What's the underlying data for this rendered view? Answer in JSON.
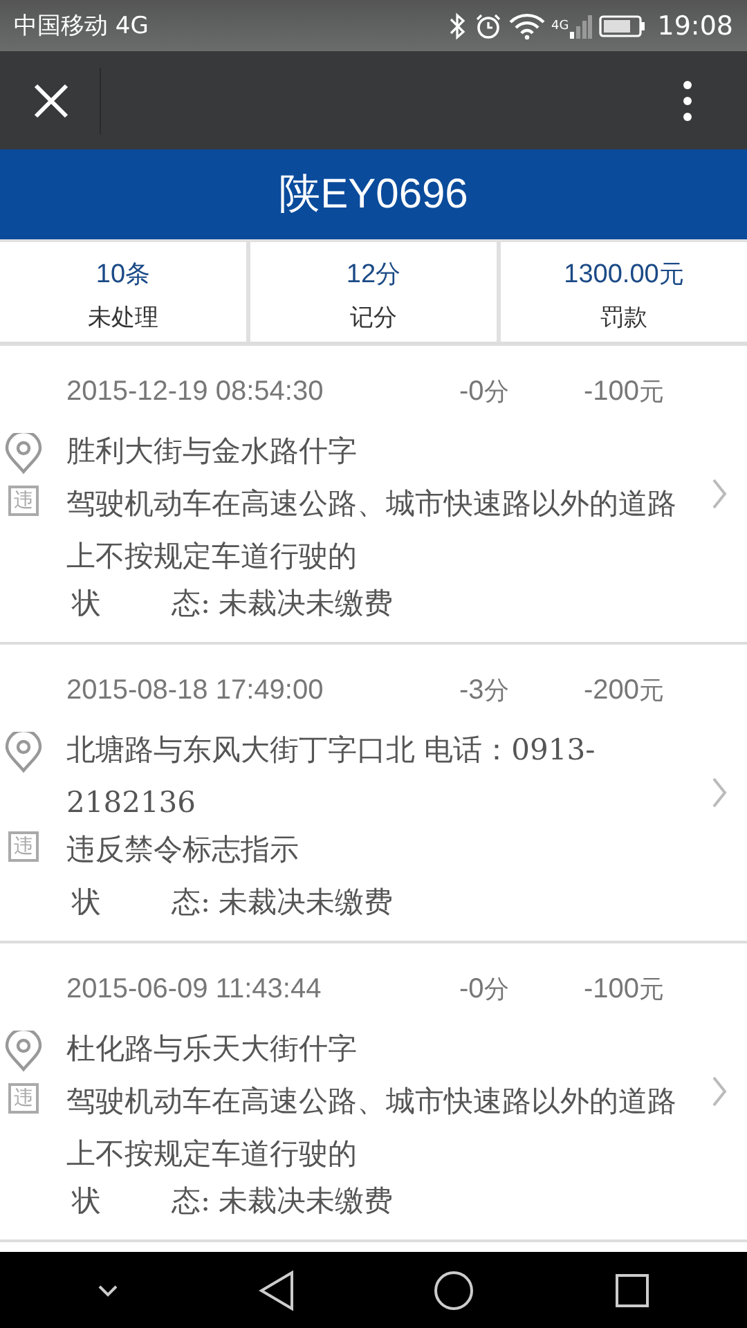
{
  "status_bar": {
    "carrier": "中国移动 4G",
    "network_badge": "4G",
    "time": "19:08"
  },
  "plate": "陕EY0696",
  "summary": [
    {
      "value": "10",
      "unit": "条",
      "label": "未处理"
    },
    {
      "value": "12",
      "unit": "分",
      "label": "记分"
    },
    {
      "value": "1300.00",
      "unit": "元",
      "label": "罚款"
    }
  ],
  "records": [
    {
      "datetime": "2015-12-19 08:54:30",
      "points": "-0",
      "points_unit": "分",
      "fine": "-100",
      "fine_unit": "元",
      "location": "胜利大街与金水路什字",
      "badge": "违",
      "violation": "驾驶机动车在高速公路、城市快速路以外的道路上不按规定车道行驶的",
      "status_label_start": "状",
      "status_label_end": "态:",
      "status": "未裁决未缴费"
    },
    {
      "datetime": "2015-08-18 17:49:00",
      "points": "-3",
      "points_unit": "分",
      "fine": "-200",
      "fine_unit": "元",
      "location": "北塘路与东风大街丁字口北 电话：0913-2182136",
      "badge": "违",
      "violation": "违反禁令标志指示",
      "status_label_start": "状",
      "status_label_end": "态:",
      "status": "未裁决未缴费"
    },
    {
      "datetime": "2015-06-09 11:43:44",
      "points": "-0",
      "points_unit": "分",
      "fine": "-100",
      "fine_unit": "元",
      "location": "杜化路与乐天大街什字",
      "badge": "违",
      "violation": "驾驶机动车在高速公路、城市快速路以外的道路上不按规定车道行驶的",
      "status_label_start": "状",
      "status_label_end": "态:",
      "status": "未裁决未缴费"
    }
  ]
}
